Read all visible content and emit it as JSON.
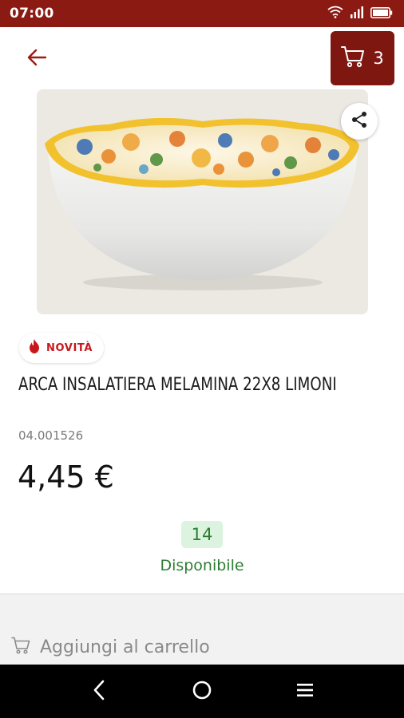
{
  "status_bar": {
    "time": "07:00",
    "icons": [
      "wifi-icon",
      "signal-icon",
      "battery-icon"
    ]
  },
  "header": {
    "back_icon": "arrow-left-icon",
    "cart_icon": "cart-icon",
    "cart_count": "3"
  },
  "product": {
    "image_icon": "bowl-image",
    "share_icon": "share-icon",
    "badge": {
      "icon": "flame-icon",
      "label": "NOVITÀ"
    },
    "title": "ARCA INSALATIERA MELAMINA 22X8 LIMONI",
    "code": "04.001526",
    "price": "4,45 €",
    "stock_quantity": "14",
    "stock_status": "Disponibile"
  },
  "actions": {
    "add_to_cart_icon": "cart-outline-icon",
    "add_to_cart_label": "Aggiungi al carrello"
  },
  "navigation": {
    "items": [
      "back-nav-icon",
      "home-nav-icon",
      "menu-nav-icon"
    ]
  },
  "colors": {
    "brand": "#8b1a12",
    "cart_button": "#7f1711",
    "accent_red": "#c8171d",
    "available_green": "#2e7d32",
    "stock_badge_bg": "#dcf3df"
  }
}
